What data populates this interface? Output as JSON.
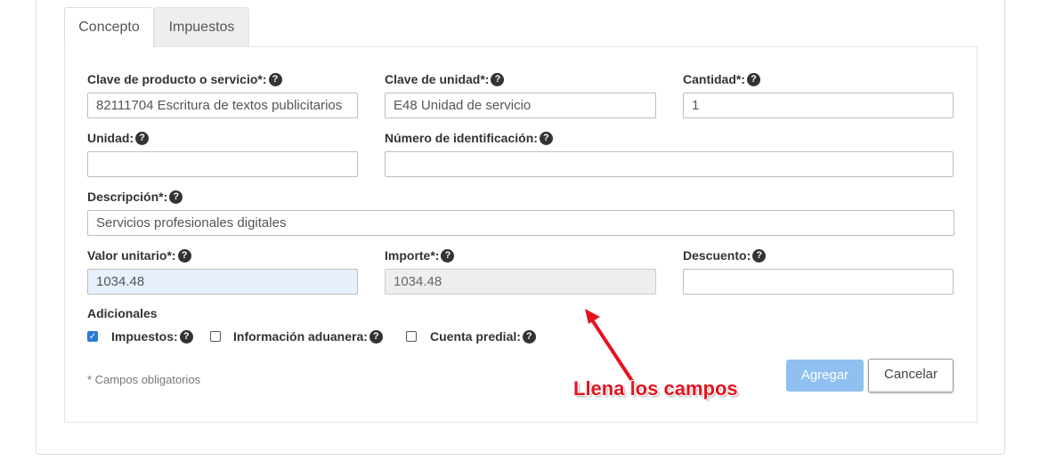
{
  "tabs": [
    {
      "label": "Concepto",
      "active": true
    },
    {
      "label": "Impuestos",
      "active": false
    }
  ],
  "help_icon": "question-circle-icon",
  "fields": {
    "clave_producto": {
      "label": "Clave de producto o servicio*:",
      "value": "82111704 Escritura de textos publicitarios"
    },
    "clave_unidad": {
      "label": "Clave de unidad*:",
      "value": "E48 Unidad de servicio"
    },
    "cantidad": {
      "label": "Cantidad*:",
      "value": "1"
    },
    "unidad": {
      "label": "Unidad:",
      "value": ""
    },
    "numero_identificacion": {
      "label": "Número de identificación:",
      "value": ""
    },
    "descripcion": {
      "label": "Descripción*:",
      "value": "Servicios profesionales digitales"
    },
    "valor_unitario": {
      "label": "Valor unitario*:",
      "value": "1034.48"
    },
    "importe": {
      "label": "Importe*:",
      "value": "1034.48"
    },
    "descuento": {
      "label": "Descuento:",
      "value": ""
    }
  },
  "adicionales": {
    "title": "Adicionales",
    "options": [
      {
        "label": "Impuestos:",
        "checked": true
      },
      {
        "label": "Información aduanera:",
        "checked": false
      },
      {
        "label": "Cuenta predial:",
        "checked": false
      }
    ]
  },
  "required_note": "* Campos obligatorios",
  "buttons": {
    "add": "Agregar",
    "cancel": "Cancelar"
  },
  "annotation": {
    "text": "Llena los campos",
    "color": "#e4141e"
  },
  "colors": {
    "primary_button": "#8fc0f0",
    "checkbox_checked": "#2b7cd3",
    "highlight_input": "#e8f0fe"
  }
}
